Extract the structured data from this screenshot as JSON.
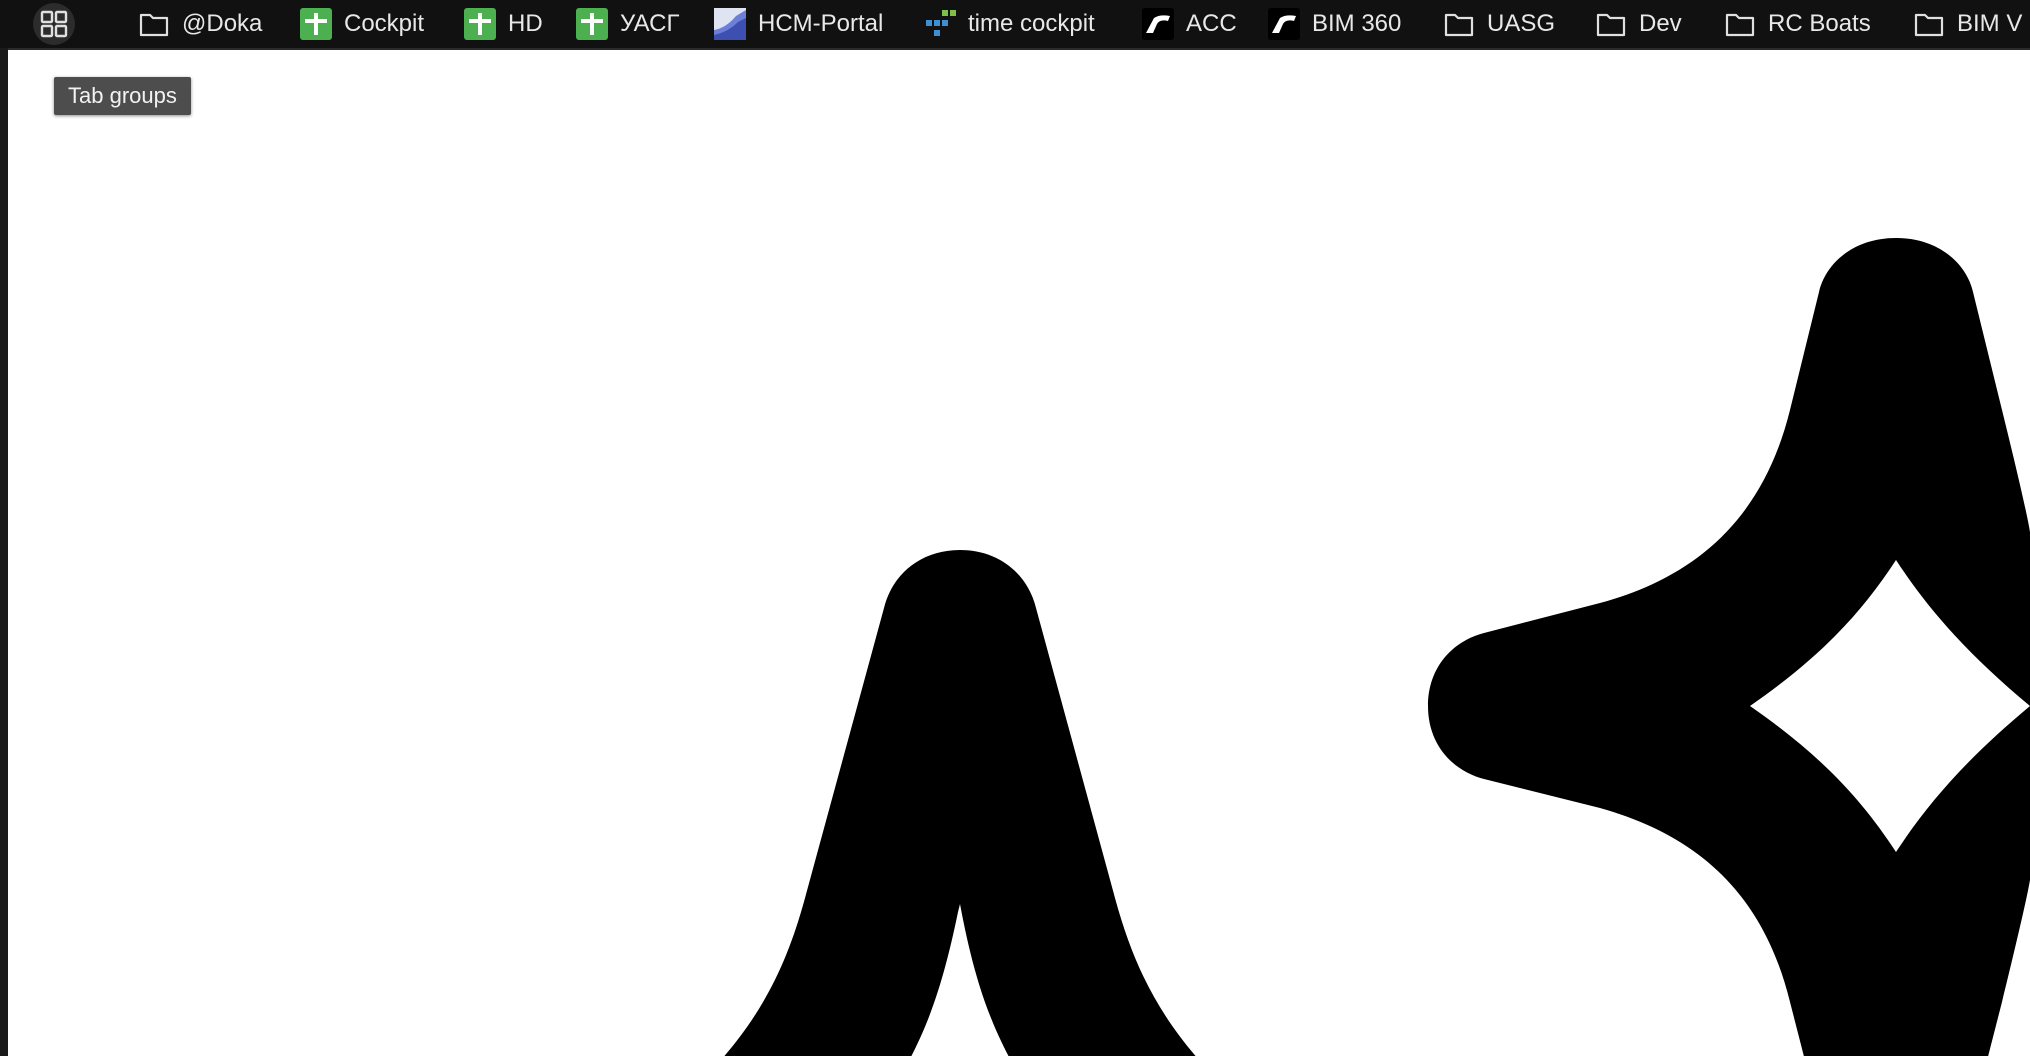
{
  "bookmarks_bar": {
    "tab_groups_icon": "grid-icon",
    "items": [
      {
        "label": "@Doka",
        "icon": "folder-icon"
      },
      {
        "label": "Cockpit",
        "icon": "green-plus-icon"
      },
      {
        "label": "HD",
        "icon": "green-plus-icon"
      },
      {
        "label": "УАСГ",
        "icon": "green-plus-icon"
      },
      {
        "label": "HCM-Portal",
        "icon": "portal-favicon-icon"
      },
      {
        "label": "time cockpit",
        "icon": "time-cockpit-icon"
      },
      {
        "label": "ACC",
        "icon": "autodesk-icon"
      },
      {
        "label": "BIM 360",
        "icon": "autodesk-icon"
      },
      {
        "label": "UASG",
        "icon": "folder-icon"
      },
      {
        "label": "Dev",
        "icon": "folder-icon"
      },
      {
        "label": "RC Boats",
        "icon": "folder-icon"
      },
      {
        "label": "BIM V",
        "icon": "folder-icon"
      }
    ]
  },
  "tooltip": {
    "text": "Tab groups"
  },
  "page": {
    "content": "sparkle-icon"
  },
  "colors": {
    "bar_background": "#111111",
    "bar_text": "#e8e8e8",
    "favicon_green": "#4caf50",
    "tooltip_background": "#4d4d4d",
    "page_background": "#ffffff",
    "sparkle_fill": "#000000"
  }
}
